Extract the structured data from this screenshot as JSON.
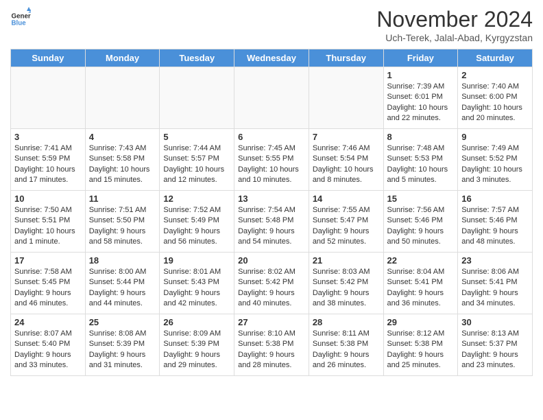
{
  "header": {
    "logo_general": "General",
    "logo_blue": "Blue",
    "month_title": "November 2024",
    "location": "Uch-Terek, Jalal-Abad, Kyrgyzstan"
  },
  "weekdays": [
    "Sunday",
    "Monday",
    "Tuesday",
    "Wednesday",
    "Thursday",
    "Friday",
    "Saturday"
  ],
  "weeks": [
    [
      {
        "day": "",
        "info": ""
      },
      {
        "day": "",
        "info": ""
      },
      {
        "day": "",
        "info": ""
      },
      {
        "day": "",
        "info": ""
      },
      {
        "day": "",
        "info": ""
      },
      {
        "day": "1",
        "info": "Sunrise: 7:39 AM\nSunset: 6:01 PM\nDaylight: 10 hours and 22 minutes."
      },
      {
        "day": "2",
        "info": "Sunrise: 7:40 AM\nSunset: 6:00 PM\nDaylight: 10 hours and 20 minutes."
      }
    ],
    [
      {
        "day": "3",
        "info": "Sunrise: 7:41 AM\nSunset: 5:59 PM\nDaylight: 10 hours and 17 minutes."
      },
      {
        "day": "4",
        "info": "Sunrise: 7:43 AM\nSunset: 5:58 PM\nDaylight: 10 hours and 15 minutes."
      },
      {
        "day": "5",
        "info": "Sunrise: 7:44 AM\nSunset: 5:57 PM\nDaylight: 10 hours and 12 minutes."
      },
      {
        "day": "6",
        "info": "Sunrise: 7:45 AM\nSunset: 5:55 PM\nDaylight: 10 hours and 10 minutes."
      },
      {
        "day": "7",
        "info": "Sunrise: 7:46 AM\nSunset: 5:54 PM\nDaylight: 10 hours and 8 minutes."
      },
      {
        "day": "8",
        "info": "Sunrise: 7:48 AM\nSunset: 5:53 PM\nDaylight: 10 hours and 5 minutes."
      },
      {
        "day": "9",
        "info": "Sunrise: 7:49 AM\nSunset: 5:52 PM\nDaylight: 10 hours and 3 minutes."
      }
    ],
    [
      {
        "day": "10",
        "info": "Sunrise: 7:50 AM\nSunset: 5:51 PM\nDaylight: 10 hours and 1 minute."
      },
      {
        "day": "11",
        "info": "Sunrise: 7:51 AM\nSunset: 5:50 PM\nDaylight: 9 hours and 58 minutes."
      },
      {
        "day": "12",
        "info": "Sunrise: 7:52 AM\nSunset: 5:49 PM\nDaylight: 9 hours and 56 minutes."
      },
      {
        "day": "13",
        "info": "Sunrise: 7:54 AM\nSunset: 5:48 PM\nDaylight: 9 hours and 54 minutes."
      },
      {
        "day": "14",
        "info": "Sunrise: 7:55 AM\nSunset: 5:47 PM\nDaylight: 9 hours and 52 minutes."
      },
      {
        "day": "15",
        "info": "Sunrise: 7:56 AM\nSunset: 5:46 PM\nDaylight: 9 hours and 50 minutes."
      },
      {
        "day": "16",
        "info": "Sunrise: 7:57 AM\nSunset: 5:46 PM\nDaylight: 9 hours and 48 minutes."
      }
    ],
    [
      {
        "day": "17",
        "info": "Sunrise: 7:58 AM\nSunset: 5:45 PM\nDaylight: 9 hours and 46 minutes."
      },
      {
        "day": "18",
        "info": "Sunrise: 8:00 AM\nSunset: 5:44 PM\nDaylight: 9 hours and 44 minutes."
      },
      {
        "day": "19",
        "info": "Sunrise: 8:01 AM\nSunset: 5:43 PM\nDaylight: 9 hours and 42 minutes."
      },
      {
        "day": "20",
        "info": "Sunrise: 8:02 AM\nSunset: 5:42 PM\nDaylight: 9 hours and 40 minutes."
      },
      {
        "day": "21",
        "info": "Sunrise: 8:03 AM\nSunset: 5:42 PM\nDaylight: 9 hours and 38 minutes."
      },
      {
        "day": "22",
        "info": "Sunrise: 8:04 AM\nSunset: 5:41 PM\nDaylight: 9 hours and 36 minutes."
      },
      {
        "day": "23",
        "info": "Sunrise: 8:06 AM\nSunset: 5:41 PM\nDaylight: 9 hours and 34 minutes."
      }
    ],
    [
      {
        "day": "24",
        "info": "Sunrise: 8:07 AM\nSunset: 5:40 PM\nDaylight: 9 hours and 33 minutes."
      },
      {
        "day": "25",
        "info": "Sunrise: 8:08 AM\nSunset: 5:39 PM\nDaylight: 9 hours and 31 minutes."
      },
      {
        "day": "26",
        "info": "Sunrise: 8:09 AM\nSunset: 5:39 PM\nDaylight: 9 hours and 29 minutes."
      },
      {
        "day": "27",
        "info": "Sunrise: 8:10 AM\nSunset: 5:38 PM\nDaylight: 9 hours and 28 minutes."
      },
      {
        "day": "28",
        "info": "Sunrise: 8:11 AM\nSunset: 5:38 PM\nDaylight: 9 hours and 26 minutes."
      },
      {
        "day": "29",
        "info": "Sunrise: 8:12 AM\nSunset: 5:38 PM\nDaylight: 9 hours and 25 minutes."
      },
      {
        "day": "30",
        "info": "Sunrise: 8:13 AM\nSunset: 5:37 PM\nDaylight: 9 hours and 23 minutes."
      }
    ]
  ]
}
